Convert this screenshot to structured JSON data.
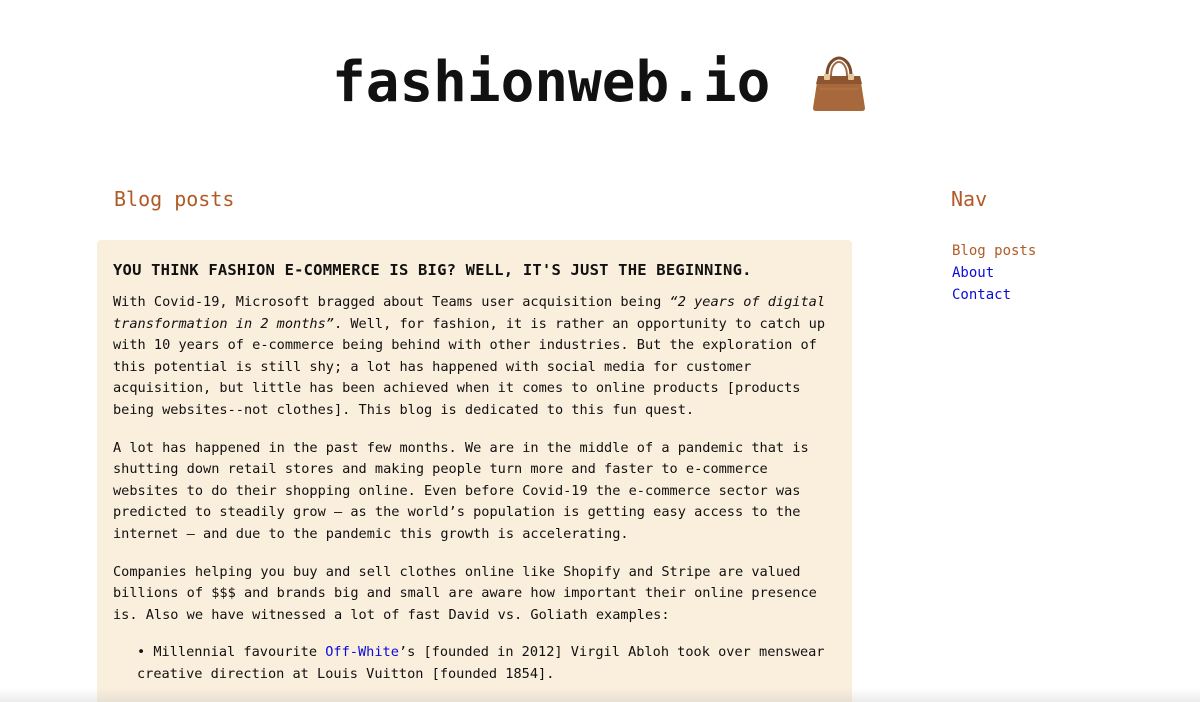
{
  "site": {
    "title": "fashionweb.io",
    "logo_icon": "handbag-icon"
  },
  "main": {
    "heading": "Blog posts"
  },
  "nav": {
    "heading": "Nav",
    "items": [
      {
        "label": "Blog posts",
        "active": true
      },
      {
        "label": "About",
        "active": false
      },
      {
        "label": "Contact",
        "active": false
      }
    ]
  },
  "post": {
    "title": "YOU THINK FASHION E-COMMERCE IS BIG? WELL, IT'S JUST THE BEGINNING.",
    "p1_a": "With Covid-19, Microsoft bragged about Teams user acquisition being ",
    "p1_quote": "“2 years of digital transformation in 2 months”",
    "p1_b": ". Well, for fashion, it is rather an opportunity to catch up with 10 years of e-commerce being behind with other industries. But the exploration of this potential is still shy; a lot has happened with social media for customer acquisition, but little has been achieved when it comes to online products [products being websites--not clothes]. This blog is dedicated to this fun quest.",
    "p2": "A lot has happened in the past few months. We are in the middle of a pandemic that is shutting down retail stores and making people turn more and faster to e-commerce websites to do their shopping online. Even before Covid-19 the e-commerce sector was predicted to steadily grow – as the world’s population is getting easy access to the internet – and due to the pandemic this growth is accelerating.",
    "p3": "Companies helping you buy and sell clothes online like Shopify and Stripe are valued billions of $$$ and brands big and small are aware how important their online presence is. Also we have witnessed a lot of fast David vs. Goliath examples:",
    "bullet1_a": "• Millennial favourite ",
    "bullet1_link": "Off-White",
    "bullet1_b": "’s [founded in 2012] Virgil Abloh took over menswear creative direction at Louis Vuitton [founded 1854]."
  },
  "colors": {
    "accent": "#b05a26",
    "link": "#0b0bd9",
    "card_bg": "#faeedc"
  }
}
